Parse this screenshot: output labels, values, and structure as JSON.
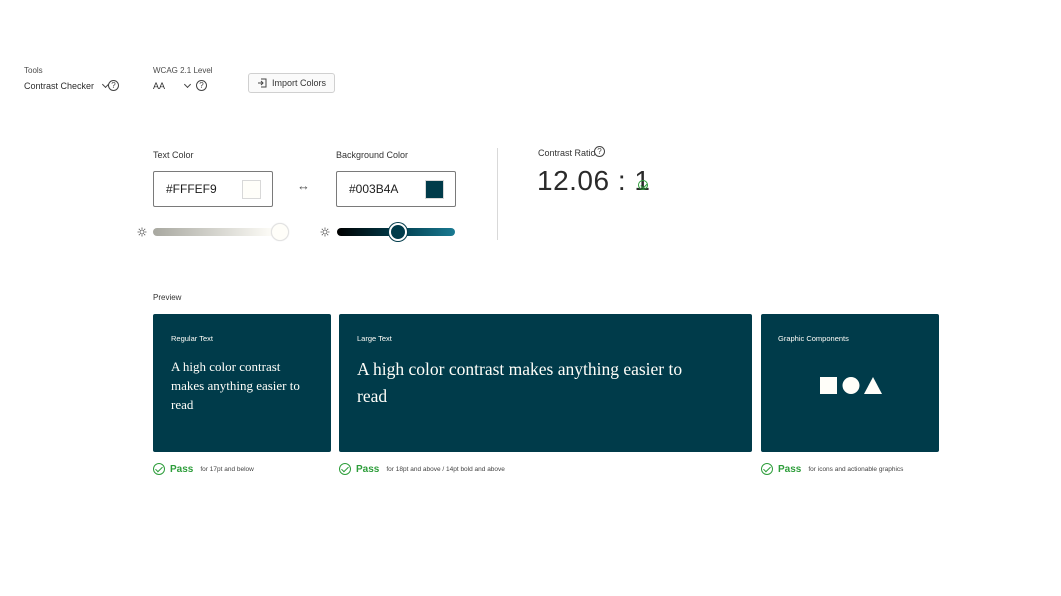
{
  "toolbar": {
    "tools_label": "Tools",
    "tools_value": "Contrast Checker",
    "wcag_label": "WCAG 2.1 Level",
    "wcag_value": "AA",
    "help_glyph": "?",
    "import_label": "Import Colors"
  },
  "text_color": {
    "label": "Text Color",
    "value": "#FFFEF9",
    "swatch": "#FFFEF9",
    "slider_level": 0.97
  },
  "swap_glyph": "↔",
  "background_color": {
    "label": "Background Color",
    "value": "#003B4A",
    "swatch": "#003B4A",
    "slider_level": 0.52
  },
  "contrast": {
    "label": "Contrast Ratio",
    "value": "12.06 : 1",
    "status": "pass"
  },
  "preview": {
    "label": "Preview",
    "cards": [
      {
        "title": "Regular Text",
        "text": "A high color contrast makes anything easier to read",
        "pass": "Pass",
        "note": "for 17pt and below"
      },
      {
        "title": "Large Text",
        "text": "A high color contrast makes anything easier to read",
        "pass": "Pass",
        "note": "for 18pt and above / 14pt bold and above"
      },
      {
        "title": "Graphic Components",
        "pass": "Pass",
        "note": "for icons and actionable graphics",
        "shapes": [
          "square-icon",
          "circle-icon",
          "triangle-icon"
        ]
      }
    ]
  },
  "colors": {
    "pass_green": "#2d9d3a",
    "card_bg": "#003b4a",
    "card_fg": "#fffef9"
  }
}
